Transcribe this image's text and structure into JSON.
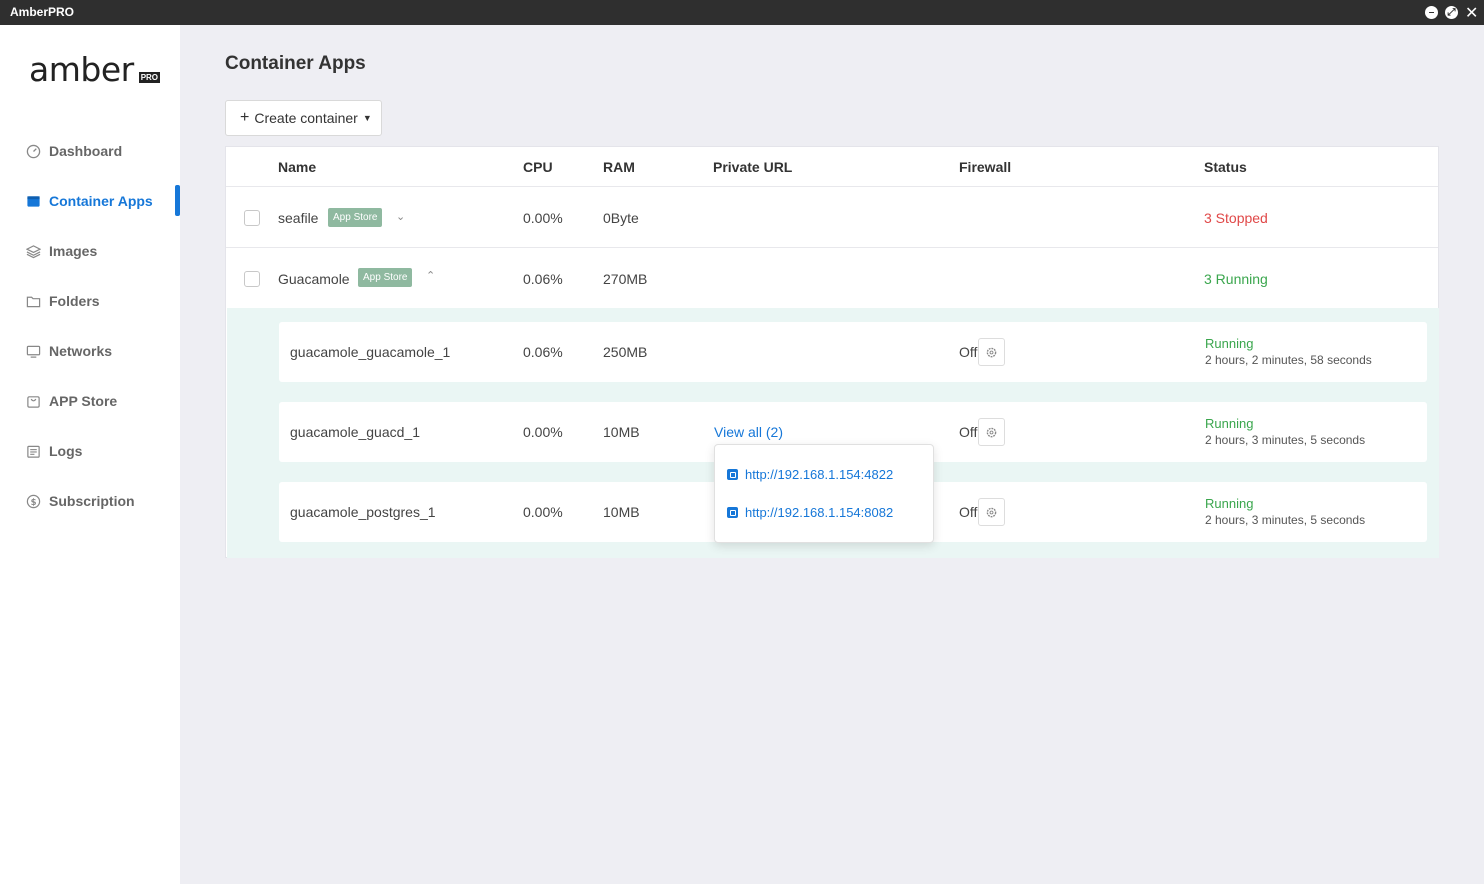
{
  "window": {
    "title": "AmberPRO"
  },
  "logo": {
    "word": "amber",
    "badge": "PRO"
  },
  "sidebar": {
    "items": [
      {
        "label": "Dashboard",
        "icon": "dashboard-icon"
      },
      {
        "label": "Container Apps",
        "icon": "container-icon",
        "active": true
      },
      {
        "label": "Images",
        "icon": "layers-icon"
      },
      {
        "label": "Folders",
        "icon": "folder-icon"
      },
      {
        "label": "Networks",
        "icon": "monitor-icon"
      },
      {
        "label": "APP Store",
        "icon": "store-icon"
      },
      {
        "label": "Logs",
        "icon": "logs-icon"
      },
      {
        "label": "Subscription",
        "icon": "dollar-icon"
      }
    ]
  },
  "main": {
    "title": "Container Apps",
    "create_button": "Create container"
  },
  "table": {
    "columns": [
      "Name",
      "CPU",
      "RAM",
      "Private URL",
      "Firewall",
      "Status"
    ],
    "apps": [
      {
        "name": "seafile",
        "badge": "App Store",
        "cpu": "0.00%",
        "ram": "0Byte",
        "status": "3 Stopped",
        "expanded": false
      },
      {
        "name": "Guacamole",
        "badge": "App Store",
        "cpu": "0.06%",
        "ram": "270MB",
        "status": "3 Running",
        "expanded": true
      }
    ],
    "containers": [
      {
        "name": "guacamole_guacamole_1",
        "cpu": "0.06%",
        "ram": "250MB",
        "url": "",
        "firewall": "Off",
        "status": "Running",
        "uptime": "2 hours, 2 minutes, 58 seconds"
      },
      {
        "name": "guacamole_guacd_1",
        "cpu": "0.00%",
        "ram": "10MB",
        "url": "View all (2)",
        "firewall": "Off",
        "status": "Running",
        "uptime": "2 hours, 3 minutes, 5 seconds"
      },
      {
        "name": "guacamole_postgres_1",
        "cpu": "0.00%",
        "ram": "10MB",
        "url": "",
        "firewall": "Off",
        "status": "Running",
        "uptime": "2 hours, 3 minutes, 5 seconds"
      }
    ]
  },
  "url_popup": {
    "links": [
      "http://192.168.1.154:4822",
      "http://192.168.1.154:8082"
    ]
  },
  "colors": {
    "accent": "#1677d8",
    "running": "#3aa64d",
    "stopped": "#e04848",
    "badge": "#8fb9a0"
  }
}
